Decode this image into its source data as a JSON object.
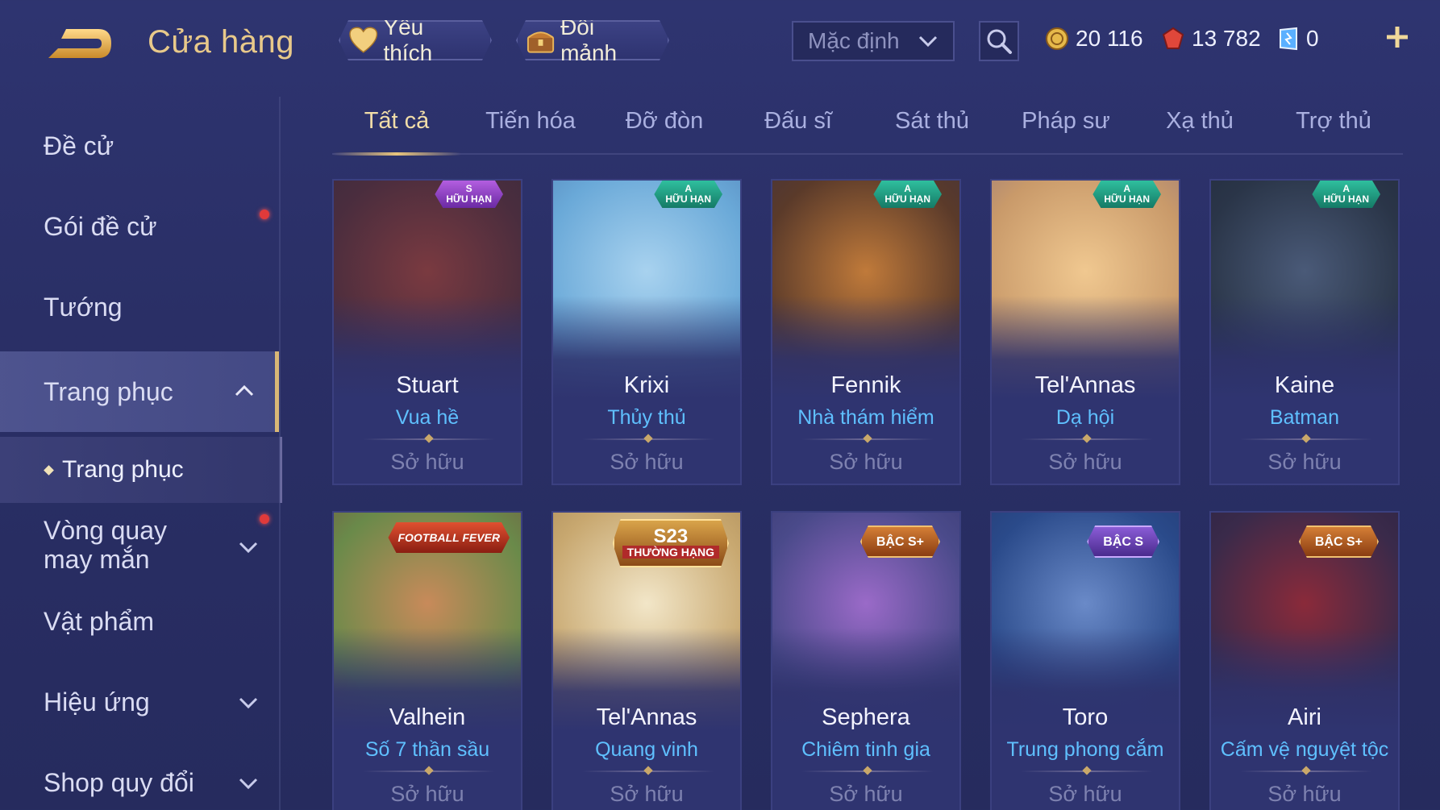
{
  "header": {
    "title": "Cửa hàng",
    "favorites_label": "Yêu thích",
    "fragments_label": "Đổi mảnh",
    "sort_value": "Mặc định",
    "currencies": [
      {
        "name": "gold",
        "value": "20 116",
        "icon": "gold-coin-icon",
        "color": "#e6b94a"
      },
      {
        "name": "gem",
        "value": "13 782",
        "icon": "ruby-gem-icon",
        "color": "#e0473a"
      },
      {
        "name": "voucher",
        "value": "0",
        "icon": "voucher-icon",
        "color": "#5ab0ff"
      }
    ]
  },
  "sidebar": {
    "items": [
      {
        "label": "Đề cử"
      },
      {
        "label": "Gói đề cử"
      },
      {
        "label": "Tướng"
      },
      {
        "label": "Trang phục"
      },
      {
        "label": "Vòng quay may mắn"
      },
      {
        "label": "Vật phẩm"
      },
      {
        "label": "Hiệu ứng"
      },
      {
        "label": "Shop quy đổi"
      }
    ],
    "sub_item": "Trang phục"
  },
  "tabs": [
    "Tất cả",
    "Tiến hóa",
    "Đỡ đòn",
    "Đấu sĩ",
    "Sát thủ",
    "Pháp sư",
    "Xạ thủ",
    "Trợ thủ"
  ],
  "cards": [
    {
      "hero": "Stuart",
      "skin": "Vua hề",
      "status": "Sở hữu",
      "badge_tier": "S",
      "badge_text": "HỮU HẠN",
      "art": [
        "#4a2d3e",
        "#7a3a40",
        "#2a2a3a"
      ]
    },
    {
      "hero": "Krixi",
      "skin": "Thủy thủ",
      "status": "Sở hữu",
      "badge_tier": "A",
      "badge_text": "HỮU HẠN",
      "art": [
        "#6aa9d8",
        "#a8d2ef",
        "#3d5f9a"
      ]
    },
    {
      "hero": "Fennik",
      "skin": "Nhà thám hiểm",
      "status": "Sở hữu",
      "badge_tier": "A",
      "badge_text": "HỮU HẠN",
      "art": [
        "#5a3a2a",
        "#c07a3a",
        "#2c2c52"
      ]
    },
    {
      "hero": "Tel'Annas",
      "skin": "Dạ hội",
      "status": "Sở hữu",
      "badge_tier": "A",
      "badge_text": "HỮU HẠN",
      "art": [
        "#c99a6a",
        "#f0c890",
        "#6a5a8a"
      ]
    },
    {
      "hero": "Kaine",
      "skin": "Batman",
      "status": "Sở hữu",
      "badge_tier": "A",
      "badge_text": "HỮU HẠN",
      "art": [
        "#2a3548",
        "#4a5a78",
        "#1c2234"
      ]
    },
    {
      "hero": "Valhein",
      "skin": "Số 7 thần sầu",
      "status": "Sở hữu",
      "badge_label": "FOOTBALL FEVER",
      "art": [
        "#6a8a4a",
        "#c88a5a",
        "#7a2a3a"
      ]
    },
    {
      "hero": "Tel'Annas",
      "skin": "Quang vinh",
      "status": "Sở hữu",
      "badge_label": "S23",
      "badge_sub": "THƯỜNG HẠNG",
      "art": [
        "#c8a870",
        "#f2e6c8",
        "#8a6a3a"
      ]
    },
    {
      "hero": "Sephera",
      "skin": "Chiêm tinh gia",
      "status": "Sở hữu",
      "badge_label": "BẬC S+",
      "art": [
        "#4a4a8a",
        "#9a6ac8",
        "#2a2a5a"
      ]
    },
    {
      "hero": "Toro",
      "skin": "Trung phong cắm",
      "status": "Sở hữu",
      "badge_label": "BẬC S",
      "art": [
        "#2a4a8a",
        "#6a8ac8",
        "#1c2a5a"
      ]
    },
    {
      "hero": "Airi",
      "skin": "Cấm vệ nguyệt tộc",
      "status": "Sở hữu",
      "badge_label": "BẬC S+",
      "art": [
        "#3a2a4a",
        "#8a2a3a",
        "#1c1c3a"
      ]
    }
  ]
}
